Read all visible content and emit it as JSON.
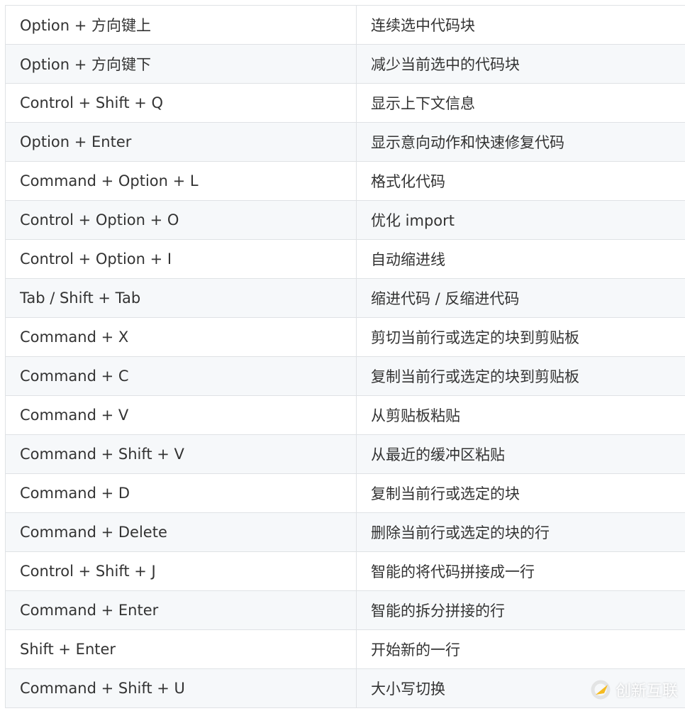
{
  "rows": [
    {
      "keys": "Option + 方向键上",
      "desc": "连续选中代码块"
    },
    {
      "keys": "Option + 方向键下",
      "desc": "减少当前选中的代码块"
    },
    {
      "keys": "Control + Shift + Q",
      "desc": "显示上下文信息"
    },
    {
      "keys": "Option + Enter",
      "desc": "显示意向动作和快速修复代码"
    },
    {
      "keys": "Command + Option + L",
      "desc": "格式化代码"
    },
    {
      "keys": "Control + Option + O",
      "desc": "优化 import"
    },
    {
      "keys": "Control + Option + I",
      "desc": "自动缩进线"
    },
    {
      "keys": "Tab / Shift + Tab",
      "desc": "缩进代码 / 反缩进代码"
    },
    {
      "keys": "Command + X",
      "desc": "剪切当前行或选定的块到剪贴板"
    },
    {
      "keys": "Command + C",
      "desc": "复制当前行或选定的块到剪贴板"
    },
    {
      "keys": "Command + V",
      "desc": "从剪贴板粘贴"
    },
    {
      "keys": "Command + Shift + V",
      "desc": "从最近的缓冲区粘贴"
    },
    {
      "keys": "Command + D",
      "desc": "复制当前行或选定的块"
    },
    {
      "keys": "Command + Delete",
      "desc": "删除当前行或选定的块的行"
    },
    {
      "keys": "Control + Shift + J",
      "desc": "智能的将代码拼接成一行"
    },
    {
      "keys": "Command + Enter",
      "desc": "智能的拆分拼接的行"
    },
    {
      "keys": "Shift + Enter",
      "desc": "开始新的一行"
    },
    {
      "keys": "Command + Shift + U",
      "desc": "大小写切换"
    }
  ],
  "watermark": {
    "text": "创新互联",
    "logo_colors": [
      "#f5b50a",
      "#d8d8d8"
    ]
  }
}
